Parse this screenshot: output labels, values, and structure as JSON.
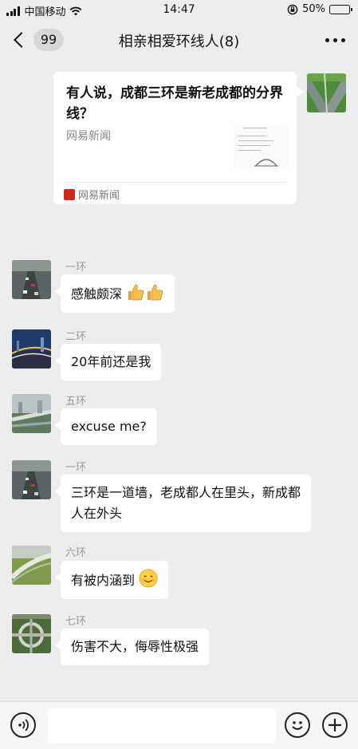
{
  "status_bar": {
    "carrier": "中国移动",
    "time": "14:47",
    "battery_percent": "50%",
    "battery_level": 0.5
  },
  "nav": {
    "unread_count": "99",
    "title": "相亲相爱环线人(8)"
  },
  "shared_article": {
    "title": "有人说，成都三环是新老成都的分界线？",
    "source": "网易新闻",
    "app_name": "网易新闻"
  },
  "messages": [
    {
      "sender": "一环",
      "text": "感触颇深",
      "emoji": [
        "thumbs-up-icon",
        "thumbs-up-icon"
      ]
    },
    {
      "sender": "二环",
      "text": "20年前还是我"
    },
    {
      "sender": "五环",
      "text": "excuse me?"
    },
    {
      "sender": "一环",
      "line1": "三环是一道墙，老成都人在里头，新成都",
      "line2": "人在外头"
    },
    {
      "sender": "六环",
      "text": "有被内涵到",
      "emoji": [
        "smiling-face-icon"
      ]
    },
    {
      "sender": "七环",
      "text": "伤害不大，侮辱性极强"
    }
  ],
  "colors": {
    "background": "#ededed",
    "bubble": "#ffffff",
    "brand_red": "#d2261b"
  }
}
